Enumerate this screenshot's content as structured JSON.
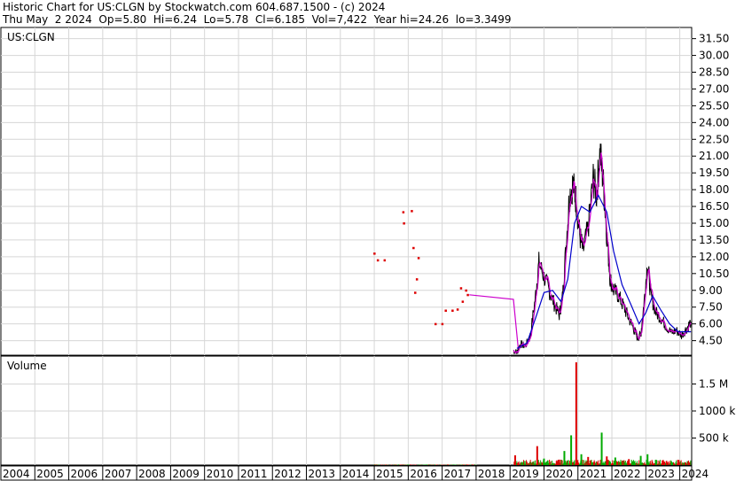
{
  "header": {
    "line1": "Historic Chart for US:CLGN by Stockwatch.com 604.687.1500 - (c) 2024",
    "line2": "Thu May  2 2024  Op=5.80  Hi=6.24  Lo=5.78  Cl=6.185  Vol=7,422  Year hi=24.26  lo=3.3499"
  },
  "chart_data": [
    {
      "type": "line",
      "title": "US:CLGN",
      "price_ticks": [
        "31.50",
        "30.00",
        "28.50",
        "27.00",
        "25.50",
        "24.00",
        "22.50",
        "21.00",
        "19.50",
        "18.00",
        "16.50",
        "15.00",
        "13.50",
        "12.00",
        "10.50",
        "9.00",
        "7.50",
        "6.00",
        "4.50"
      ],
      "ylim": [
        3.2,
        32.5
      ],
      "grid": true,
      "colors": {
        "price": "#000000",
        "ma_short": "#cc00cc",
        "ma_long": "#0000cc",
        "sparse_trades": "#dd0000"
      },
      "sparse_points": [
        {
          "x": 2015.0,
          "y": 12.3
        },
        {
          "x": 2015.1,
          "y": 11.7
        },
        {
          "x": 2015.3,
          "y": 11.7
        },
        {
          "x": 2015.85,
          "y": 16.0
        },
        {
          "x": 2015.87,
          "y": 15.0
        },
        {
          "x": 2016.1,
          "y": 16.1
        },
        {
          "x": 2016.15,
          "y": 12.8
        },
        {
          "x": 2016.3,
          "y": 11.9
        },
        {
          "x": 2016.25,
          "y": 10.0
        },
        {
          "x": 2016.2,
          "y": 8.8
        },
        {
          "x": 2016.8,
          "y": 6.0
        },
        {
          "x": 2017.0,
          "y": 6.0
        },
        {
          "x": 2017.1,
          "y": 7.2
        },
        {
          "x": 2017.3,
          "y": 7.2
        },
        {
          "x": 2017.45,
          "y": 7.3
        },
        {
          "x": 2017.55,
          "y": 9.2
        },
        {
          "x": 2017.6,
          "y": 8.0
        },
        {
          "x": 2017.7,
          "y": 9.0
        },
        {
          "x": 2017.75,
          "y": 8.6
        }
      ],
      "ma_short_flat": [
        [
          2017.8,
          8.6
        ],
        [
          2019.1,
          8.2
        ],
        [
          2019.25,
          3.5
        ]
      ],
      "price_series": [
        [
          2019.1,
          3.6
        ],
        [
          2019.2,
          3.4
        ],
        [
          2019.3,
          4.2
        ],
        [
          2019.45,
          4.0
        ],
        [
          2019.6,
          5.0
        ],
        [
          2019.75,
          8.5
        ],
        [
          2019.85,
          11.5
        ],
        [
          2020.0,
          10.2
        ],
        [
          2020.15,
          9.0
        ],
        [
          2020.3,
          7.8
        ],
        [
          2020.45,
          6.8
        ],
        [
          2020.55,
          8.5
        ],
        [
          2020.65,
          13.0
        ],
        [
          2020.75,
          17.5
        ],
        [
          2020.85,
          18.5
        ],
        [
          2020.95,
          17.0
        ],
        [
          2021.05,
          14.0
        ],
        [
          2021.15,
          12.5
        ],
        [
          2021.3,
          14.5
        ],
        [
          2021.45,
          19.0
        ],
        [
          2021.55,
          17.5
        ],
        [
          2021.65,
          21.5
        ],
        [
          2021.75,
          18.5
        ],
        [
          2021.85,
          14.0
        ],
        [
          2021.95,
          10.0
        ],
        [
          2022.05,
          9.0
        ],
        [
          2022.2,
          8.5
        ],
        [
          2022.35,
          7.5
        ],
        [
          2022.5,
          6.5
        ],
        [
          2022.65,
          5.5
        ],
        [
          2022.75,
          4.8
        ],
        [
          2022.85,
          5.0
        ],
        [
          2022.95,
          8.0
        ],
        [
          2023.05,
          11.5
        ],
        [
          2023.15,
          8.5
        ],
        [
          2023.3,
          7.0
        ],
        [
          2023.45,
          6.5
        ],
        [
          2023.6,
          5.8
        ],
        [
          2023.75,
          5.2
        ],
        [
          2023.9,
          5.4
        ],
        [
          2024.05,
          5.0
        ],
        [
          2024.2,
          5.6
        ],
        [
          2024.33,
          6.185
        ]
      ],
      "ma_long": [
        [
          2019.2,
          3.8
        ],
        [
          2019.5,
          4.3
        ],
        [
          2019.75,
          6.5
        ],
        [
          2020.0,
          8.8
        ],
        [
          2020.25,
          9.0
        ],
        [
          2020.5,
          8.0
        ],
        [
          2020.7,
          10.0
        ],
        [
          2020.9,
          15.0
        ],
        [
          2021.1,
          16.5
        ],
        [
          2021.35,
          16.0
        ],
        [
          2021.6,
          17.5
        ],
        [
          2021.85,
          16.0
        ],
        [
          2022.05,
          12.5
        ],
        [
          2022.3,
          9.5
        ],
        [
          2022.55,
          7.8
        ],
        [
          2022.8,
          6.0
        ],
        [
          2023.0,
          7.0
        ],
        [
          2023.2,
          8.5
        ],
        [
          2023.45,
          7.2
        ],
        [
          2023.7,
          6.0
        ],
        [
          2023.95,
          5.3
        ],
        [
          2024.33,
          5.3
        ]
      ]
    },
    {
      "type": "bar",
      "title": "Volume",
      "volume_ticks": [
        "1.5 M",
        "1000 k",
        "500 k"
      ],
      "colors": {
        "up": "#00aa00",
        "down": "#dd0000"
      },
      "spikes": [
        {
          "x": 2019.15,
          "v": 180000,
          "dir": "down"
        },
        {
          "x": 2019.8,
          "v": 350000,
          "dir": "down"
        },
        {
          "x": 2020.0,
          "v": 120000,
          "dir": "up"
        },
        {
          "x": 2020.45,
          "v": 100000,
          "dir": "down"
        },
        {
          "x": 2020.6,
          "v": 260000,
          "dir": "up"
        },
        {
          "x": 2020.8,
          "v": 550000,
          "dir": "up"
        },
        {
          "x": 2020.95,
          "v": 1900000,
          "dir": "down"
        },
        {
          "x": 2021.1,
          "v": 200000,
          "dir": "up"
        },
        {
          "x": 2021.3,
          "v": 150000,
          "dir": "down"
        },
        {
          "x": 2021.7,
          "v": 600000,
          "dir": "up"
        },
        {
          "x": 2021.85,
          "v": 160000,
          "dir": "down"
        },
        {
          "x": 2022.1,
          "v": 140000,
          "dir": "up"
        },
        {
          "x": 2022.5,
          "v": 110000,
          "dir": "down"
        },
        {
          "x": 2022.85,
          "v": 170000,
          "dir": "up"
        },
        {
          "x": 2023.05,
          "v": 200000,
          "dir": "up"
        },
        {
          "x": 2023.5,
          "v": 90000,
          "dir": "down"
        }
      ]
    }
  ],
  "x_axis": {
    "years": [
      "2004",
      "2005",
      "2006",
      "2007",
      "2008",
      "2009",
      "2010",
      "2011",
      "2012",
      "2013",
      "2014",
      "2015",
      "2016",
      "2017",
      "2018",
      "2019",
      "2020",
      "2021",
      "2022",
      "2023",
      "2024"
    ],
    "range": [
      2004.0,
      2024.35
    ]
  }
}
